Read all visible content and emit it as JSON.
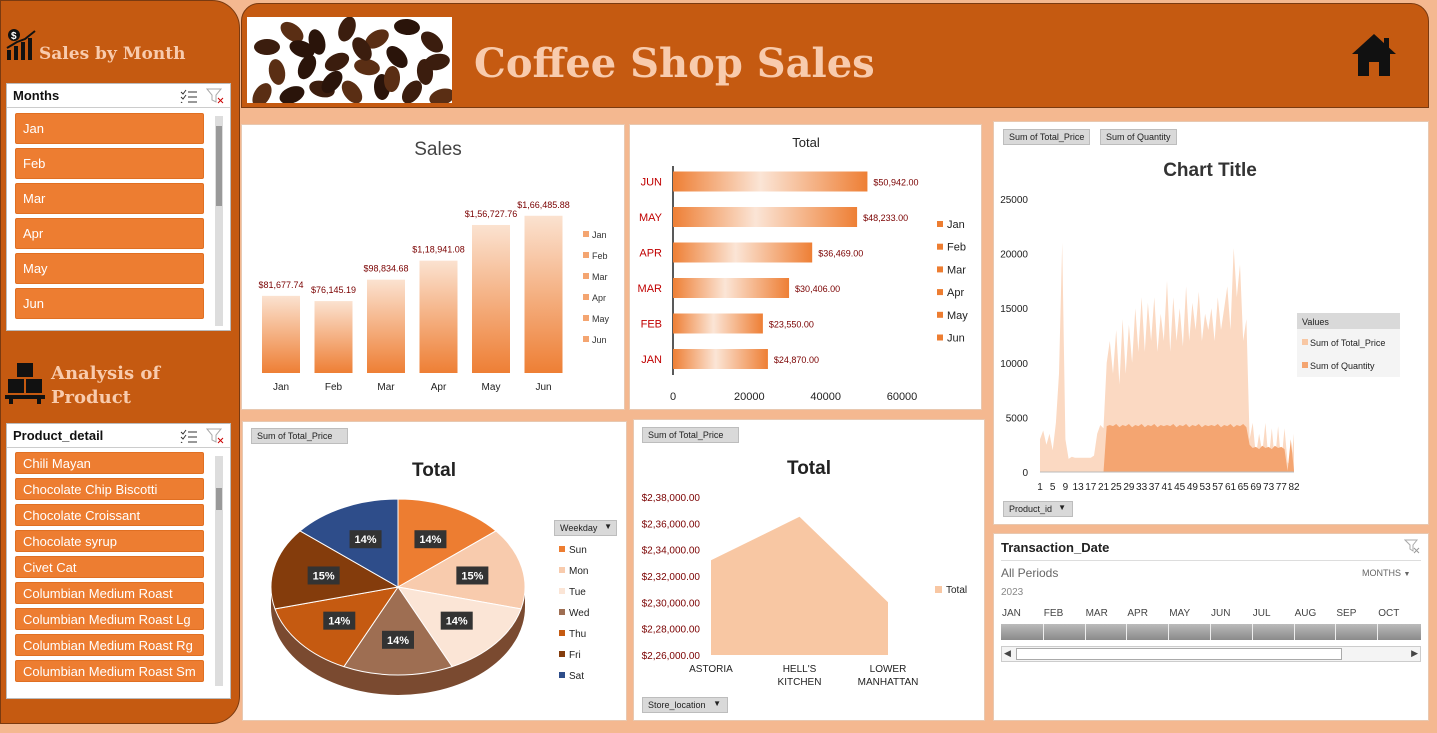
{
  "sidebar": {
    "months_section_title": "Sales by Month",
    "months_slicer_header": "Months",
    "months": [
      "Jan",
      "Feb",
      "Mar",
      "Apr",
      "May",
      "Jun"
    ],
    "product_section_title_1": "Analysis of",
    "product_section_title_2": "Product",
    "product_slicer_header": "Product_detail",
    "products": [
      "Chili Mayan",
      "Chocolate Chip Biscotti",
      "Chocolate Croissant",
      "Chocolate syrup",
      "Civet Cat",
      "Columbian Medium Roast",
      "Columbian Medium Roast Lg",
      "Columbian Medium Roast Rg",
      "Columbian Medium Roast Sm"
    ]
  },
  "header": {
    "title": "Coffee Shop Sales"
  },
  "pivot_buttons": {
    "area_price": "Sum of Total_Price",
    "area_qty": "Sum of Quantity",
    "area_axis": "Product_id",
    "pie_value": "Sum of Total_Price",
    "pie_legend": "Weekday",
    "store_value": "Sum of Total_Price",
    "store_axis": "Store_location"
  },
  "timeline": {
    "title": "Transaction_Date",
    "period_label": "All Periods",
    "unit_label": "MONTHS",
    "year": "2023",
    "months": [
      "JAN",
      "FEB",
      "MAR",
      "APR",
      "MAY",
      "JUN",
      "JUL",
      "AUG",
      "SEP",
      "OCT"
    ]
  },
  "chart_data": [
    {
      "type": "bar",
      "title": "Sales",
      "categories": [
        "Jan",
        "Feb",
        "Mar",
        "Apr",
        "May",
        "Jun"
      ],
      "values": [
        81677.74,
        76145.19,
        98834.68,
        118941.08,
        156727.76,
        166485.88
      ],
      "data_labels": [
        "$81,677.74",
        "$76,145.19",
        "$98,834.68",
        "$1,18,941.08",
        "$1,56,727.76",
        "$1,66,485.88"
      ],
      "legend": [
        "Jan",
        "Feb",
        "Mar",
        "Apr",
        "May",
        "Jun"
      ],
      "ylim": [
        0,
        180000
      ],
      "color": "#ed7d31"
    },
    {
      "type": "bar",
      "orientation": "horizontal",
      "title": "Total",
      "categories": [
        "JAN",
        "FEB",
        "MAR",
        "APR",
        "MAY",
        "JUN"
      ],
      "values": [
        24870,
        23550,
        30406,
        36469,
        48233,
        50942
      ],
      "data_labels": [
        "$24,870.00",
        "$23,550.00",
        "$30,406.00",
        "$36,469.00",
        "$48,233.00",
        "$50,942.00"
      ],
      "xticks": [
        "0",
        "20000",
        "40000",
        "60000"
      ],
      "xlim": [
        0,
        60000
      ],
      "legend": [
        "Jan",
        "Feb",
        "Mar",
        "Apr",
        "May",
        "Jun"
      ]
    },
    {
      "type": "area",
      "title": "Chart Title",
      "x_tick_labels": [
        "1",
        "5",
        "9",
        "13",
        "17",
        "21",
        "25",
        "29",
        "33",
        "37",
        "41",
        "45",
        "49",
        "53",
        "57",
        "61",
        "65",
        "69",
        "73",
        "77",
        "82"
      ],
      "yticks": [
        "0",
        "5000",
        "10000",
        "15000",
        "20000",
        "25000"
      ],
      "ylim": [
        0,
        25000
      ],
      "legend_title": "Values",
      "series": [
        {
          "name": "Sum of Total_Price",
          "color": "#fbd9c2",
          "values": [
            3000,
            3800,
            2500,
            3500,
            2000,
            4500,
            9000,
            21000,
            3000,
            1200,
            1400,
            1300,
            1300,
            1300,
            1300,
            1300,
            1300,
            1500,
            3500,
            4300,
            4000,
            10000,
            12000,
            9000,
            13000,
            8000,
            14000,
            9000,
            13500,
            10000,
            15000,
            11000,
            16000,
            11000,
            15500,
            12000,
            16000,
            11000,
            14500,
            12000,
            17500,
            11000,
            16000,
            12000,
            15000,
            11500,
            17000,
            12000,
            15500,
            13000,
            16500,
            12000,
            14500,
            13000,
            15000,
            12000,
            16000,
            13000,
            15000,
            17000,
            13000,
            20500,
            16000,
            19000,
            12000,
            14000,
            3000,
            4500,
            1500,
            3500,
            1800,
            4500,
            1000,
            4000,
            1000,
            4200,
            800,
            4000,
            900,
            500,
            3500
          ]
        },
        {
          "name": "Sum of Quantity",
          "color": "#f4a571",
          "values": [
            0,
            0,
            0,
            0,
            0,
            0,
            0,
            0,
            0,
            0,
            0,
            0,
            0,
            0,
            0,
            0,
            0,
            0,
            0,
            0,
            0,
            4200,
            4300,
            4200,
            4400,
            4100,
            4300,
            4200,
            4400,
            4100,
            4300,
            4200,
            4400,
            4100,
            4300,
            4200,
            4400,
            4100,
            4300,
            4200,
            4300,
            4200,
            4400,
            4100,
            4300,
            4200,
            4400,
            4100,
            4300,
            4200,
            4400,
            4100,
            4300,
            4200,
            4300,
            4200,
            4400,
            4100,
            4300,
            4200,
            4400,
            4100,
            4300,
            4200,
            4400,
            4100,
            2500,
            2200,
            2300,
            2100,
            2400,
            2200,
            2300,
            2100,
            2400,
            2200,
            2300,
            2100,
            100,
            3000,
            100
          ]
        }
      ]
    },
    {
      "type": "pie",
      "title": "Total",
      "categories": [
        "Sun",
        "Mon",
        "Tue",
        "Wed",
        "Thu",
        "Fri",
        "Sat"
      ],
      "values": [
        14,
        15,
        14,
        14,
        14,
        15,
        14
      ],
      "data_labels": [
        "14%",
        "15%",
        "14%",
        "14%",
        "14%",
        "15%",
        "14%"
      ],
      "colors": [
        "#ed7d31",
        "#f8cbad",
        "#fbe5d6",
        "#9e6e52",
        "#c55a11",
        "#843c0c",
        "#2e4d8a"
      ]
    },
    {
      "type": "area",
      "title": "Total",
      "categories": [
        "ASTORIA",
        "HELL'S KITCHEN",
        "LOWER MANHATTAN"
      ],
      "category_labels": [
        [
          "ASTORIA"
        ],
        [
          "HELL'S",
          "KITCHEN"
        ],
        [
          "LOWER",
          "MANHATTAN"
        ]
      ],
      "values": [
        2332000,
        2365000,
        2300000
      ],
      "yticks": [
        "$2,26,000.00",
        "$2,28,000.00",
        "$2,30,000.00",
        "$2,32,000.00",
        "$2,34,000.00",
        "$2,36,000.00",
        "$2,38,000.00"
      ],
      "ylim": [
        2260000,
        2380000
      ],
      "legend": [
        "Total"
      ],
      "color": "#f8c7a3"
    }
  ]
}
